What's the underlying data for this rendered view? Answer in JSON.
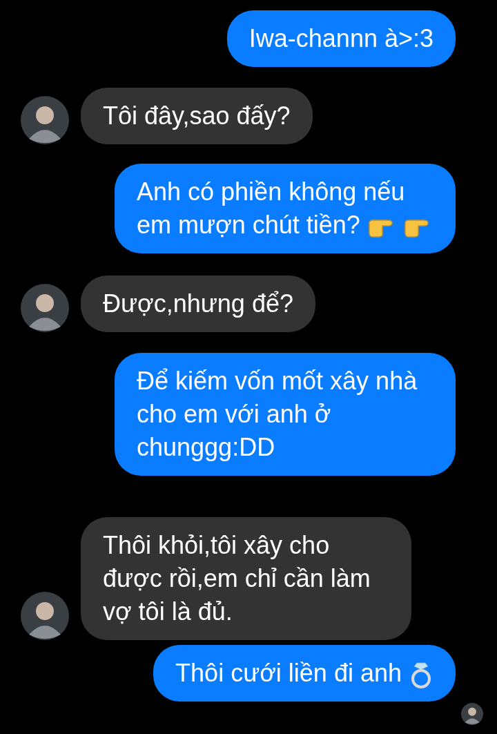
{
  "messages": [
    {
      "kind": "outgoing",
      "text": "Iwa-channn à>:3"
    },
    {
      "kind": "incoming",
      "text": "Tôi đây,sao đấy?",
      "avatar": true
    },
    {
      "kind": "outgoing",
      "text": "Anh có phiền không nếu em mượn chút tiền?",
      "emoji": [
        {
          "kind": "point"
        },
        {
          "kind": "point"
        }
      ]
    },
    {
      "kind": "incoming",
      "text": "Được,nhưng để?",
      "avatar": true
    },
    {
      "kind": "outgoing",
      "text": "Để kiếm vốn mốt xây nhà cho em với anh ở chunggg:DD"
    },
    {
      "kind": "incoming",
      "text": "Thôi khỏi,tôi xây cho được rồi,em chỉ cần làm vợ tôi là đủ.",
      "avatar": true
    },
    {
      "kind": "outgoing",
      "text": "Thôi cưới liền đi anh",
      "emoji": [
        {
          "kind": "ring"
        }
      ],
      "seen": true
    }
  ]
}
